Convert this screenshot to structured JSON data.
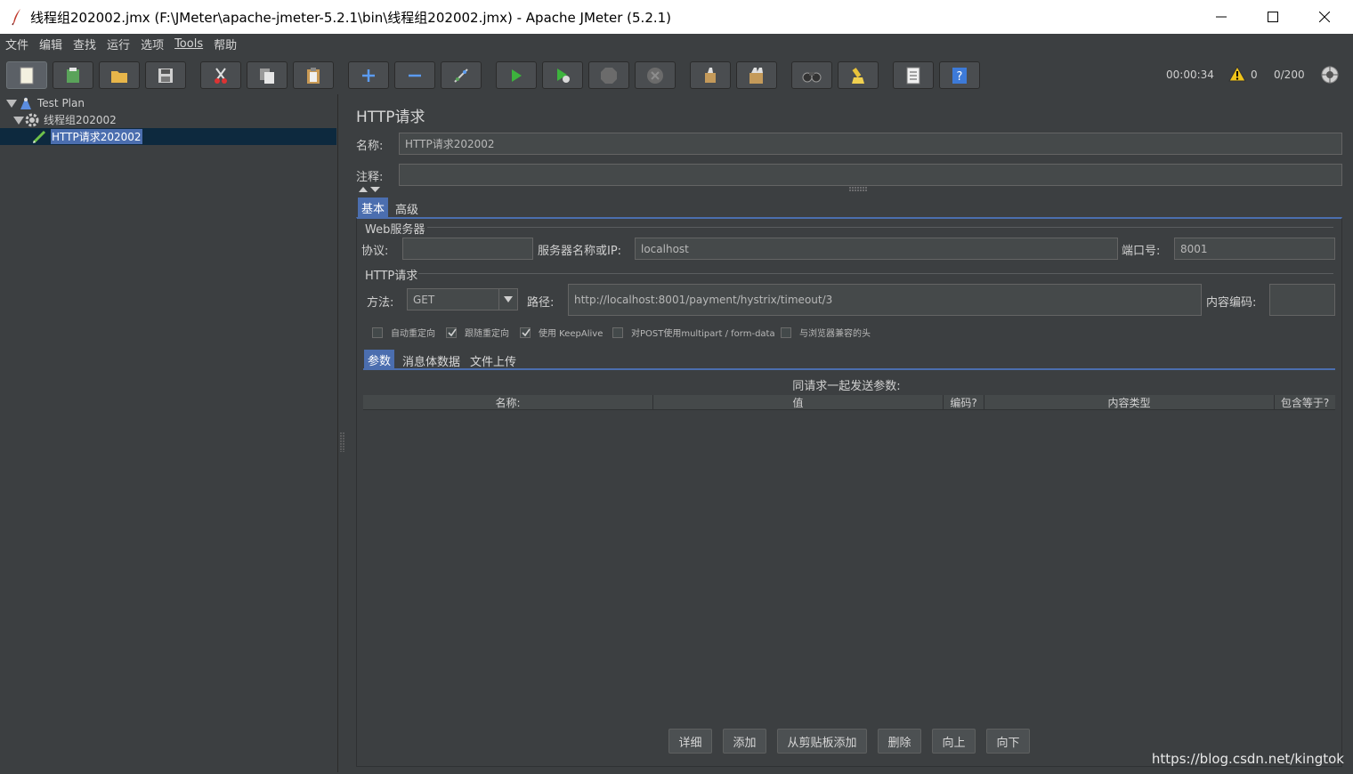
{
  "window": {
    "title": "线程组202002.jmx (F:\\JMeter\\apache-jmeter-5.2.1\\bin\\线程组202002.jmx) - Apache JMeter (5.2.1)",
    "minimize": "—",
    "maximize": "☐",
    "close": "✕"
  },
  "menu": [
    "文件",
    "编辑",
    "查找",
    "运行",
    "选项",
    "Tools",
    "帮助"
  ],
  "toolbar": {
    "icons": [
      "new-icon",
      "templates-icon",
      "open-icon",
      "save-icon",
      "cut-icon",
      "copy-icon",
      "paste-icon",
      "expand-icon",
      "collapse-icon",
      "toggle-icon",
      "start-icon",
      "start-no-pause-icon",
      "stop-icon",
      "shutdown-icon",
      "clear-icon",
      "clear-all-icon",
      "search-icon",
      "reset-search-icon",
      "function-helper-icon",
      "help-icon"
    ],
    "timer": "00:00:34",
    "warnings": "0",
    "threads": "0/200"
  },
  "tree": {
    "items": [
      {
        "label": "Test Plan",
        "icon": "test-plan-icon"
      },
      {
        "label": "线程组202002",
        "icon": "gear-icon"
      },
      {
        "label": "HTTP请求202002",
        "icon": "pencil-icon"
      }
    ]
  },
  "panel": {
    "heading": "HTTP请求",
    "name_label": "名称:",
    "name_value": "HTTP请求202002",
    "comment_label": "注释:",
    "comment_value": "",
    "tabs": [
      "基本",
      "高级"
    ],
    "web_server": {
      "group_title": "Web服务器",
      "protocol_label": "协议:",
      "protocol_value": "",
      "server_label": "服务器名称或IP:",
      "server_value": "localhost",
      "port_label": "端口号:",
      "port_value": "8001"
    },
    "http_request": {
      "group_title": "HTTP请求",
      "method_label": "方法:",
      "method_value": "GET",
      "path_label": "路径:",
      "path_value": "http://localhost:8001/payment/hystrix/timeout/3",
      "encoding_label": "内容编码:",
      "encoding_value": ""
    },
    "checkboxes": [
      {
        "label": "自动重定向",
        "checked": false
      },
      {
        "label": "跟随重定向",
        "checked": true
      },
      {
        "label": "使用 KeepAlive",
        "checked": true
      },
      {
        "label": "对POST使用multipart / form-data",
        "checked": false
      },
      {
        "label": "与浏览器兼容的头",
        "checked": false
      }
    ],
    "sub_tabs": [
      "参数",
      "消息体数据",
      "文件上传"
    ],
    "params_title": "同请求一起发送参数:",
    "columns": [
      "名称:",
      "值",
      "编码?",
      "内容类型",
      "包含等于?"
    ],
    "rows": [],
    "buttons": [
      "详细",
      "添加",
      "从剪贴板添加",
      "删除",
      "向上",
      "向下"
    ]
  },
  "watermark": "https://blog.csdn.net/kingtok",
  "colors": {
    "background": "#3c3f41",
    "selection": "#4b6eaf",
    "tree_selection": "#0d293e"
  }
}
